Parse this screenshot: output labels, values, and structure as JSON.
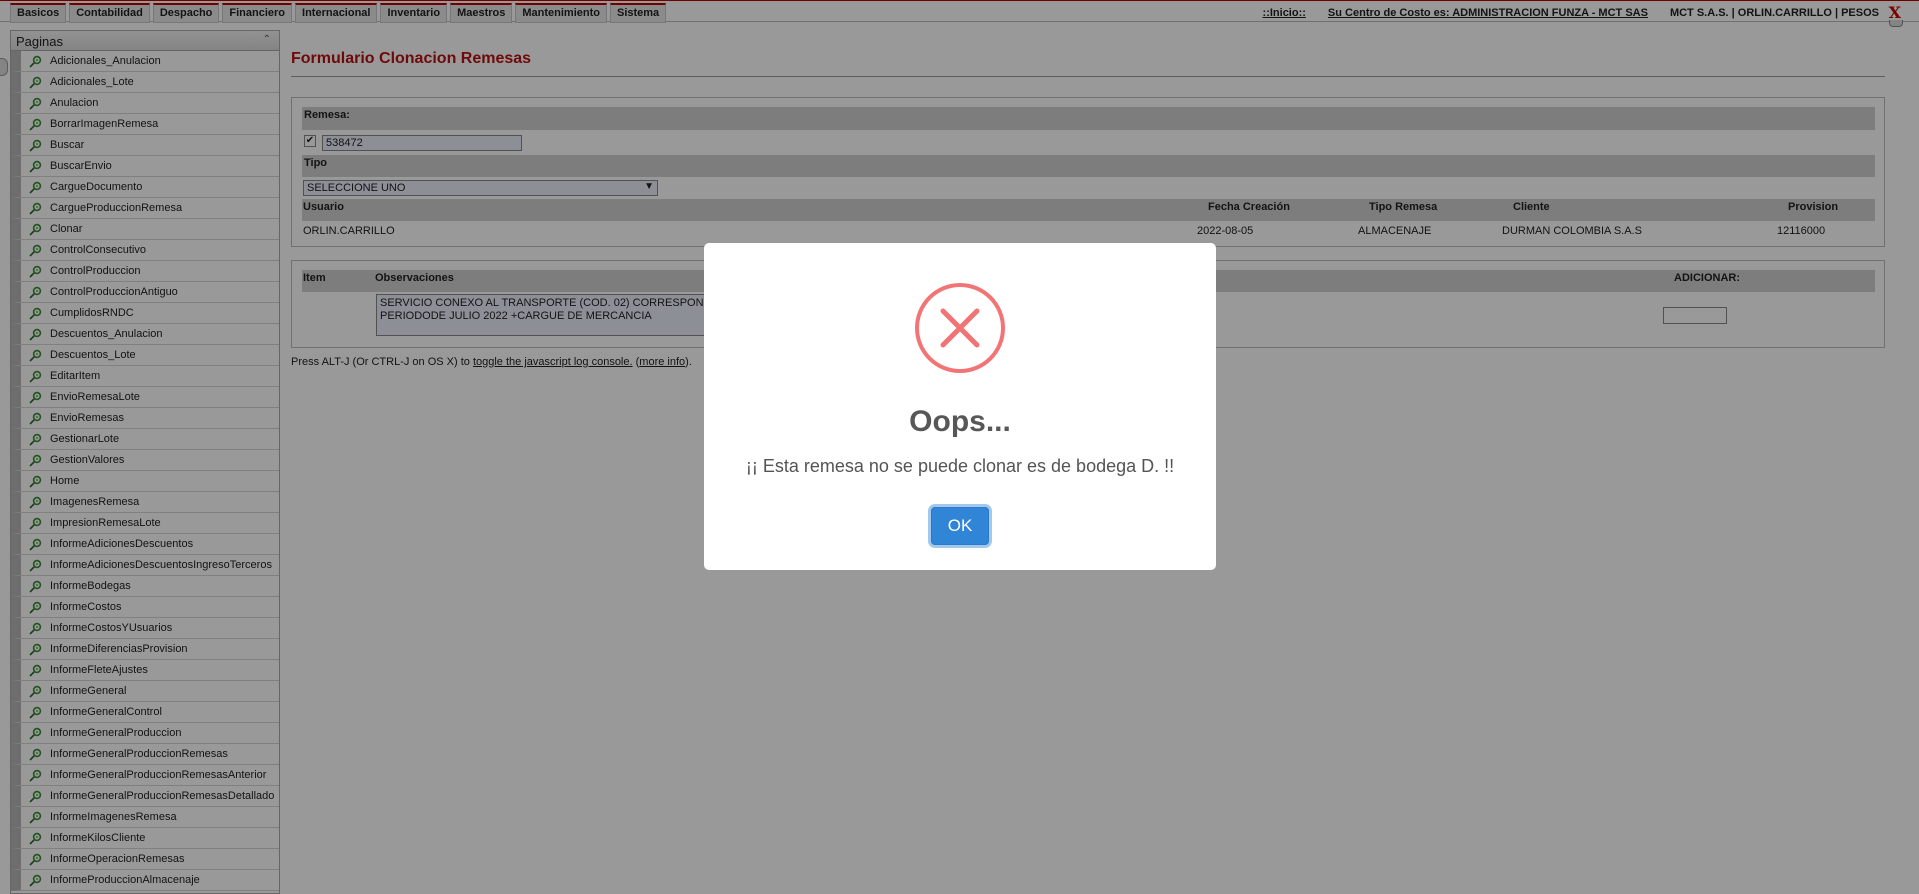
{
  "topbar": {
    "menu": [
      "Basicos",
      "Contabilidad",
      "Despacho",
      "Financiero",
      "Internacional",
      "Inventario",
      "Maestros",
      "Mantenimiento",
      "Sistema"
    ],
    "inicio": "::Inicio::",
    "cost_center": "Su Centro de Costo es: ADMINISTRACION FUNZA - MCT SAS",
    "user_info": "MCT S.A.S. | ORLIN.CARRILLO | PESOS",
    "close": "X"
  },
  "sidebar": {
    "title": "Paginas",
    "collapse_glyph": "⌃",
    "items": [
      "Adicionales_Anulacion",
      "Adicionales_Lote",
      "Anulacion",
      "BorrarImagenRemesa",
      "Buscar",
      "BuscarEnvio",
      "CargueDocumento",
      "CargueProduccionRemesa",
      "Clonar",
      "ControlConsecutivo",
      "ControlProduccion",
      "ControlProduccionAntiguo",
      "CumplidosRNDC",
      "Descuentos_Anulacion",
      "Descuentos_Lote",
      "EditarItem",
      "EnvioRemesaLote",
      "EnvioRemesas",
      "GestionarLote",
      "GestionValores",
      "Home",
      "ImagenesRemesa",
      "ImpresionRemesaLote",
      "InformeAdicionesDescuentos",
      "InformeAdicionesDescuentosIngresoTerceros",
      "InformeBodegas",
      "InformeCostos",
      "InformeCostosYUsuarios",
      "InformeDiferenciasProvision",
      "InformeFleteAjustes",
      "InformeGeneral",
      "InformeGeneralControl",
      "InformeGeneralProduccion",
      "InformeGeneralProduccionRemesas",
      "InformeGeneralProduccionRemesasAnterior",
      "InformeGeneralProduccionRemesasDetallado",
      "InformeImagenesRemesa",
      "InformeKilosCliente",
      "InformeOperacionRemesas",
      "InformeProduccionAlmacenaje"
    ]
  },
  "form": {
    "title": "Formulario Clonacion Remesas",
    "remesa_label": "Remesa:",
    "remesa_checked": "✔",
    "remesa_value": "538472",
    "tipo_label": "Tipo",
    "tipo_selected": "SELECCIONE UNO",
    "columns": {
      "usuario": "Usuario",
      "fecha": "Fecha Creación",
      "tipo_remesa": "Tipo Remesa",
      "cliente": "Cliente",
      "provision": "Provision"
    },
    "row": {
      "usuario": "ORLIN.CARRILLO",
      "fecha": "2022-08-05",
      "tipo_remesa": "ALMACENAJE",
      "cliente": "DURMAN COLOMBIA S.A.S",
      "provision": "12116000"
    },
    "items_header": {
      "item": "Item",
      "observaciones": "Observaciones",
      "adicionar": "ADICIONAR:"
    },
    "observaciones_text": "SERVICIO CONEXO AL TRANSPORTE (COD. 02) CORRESPONDIENTE AL PERIODODE JULIO 2022 +CARGUE DE MERCANCIA"
  },
  "log_hint": {
    "prefix": "Press ALT-J (Or CTRL-J on OS X) to ",
    "toggle_link": "toggle the javascript log console.",
    "mid": " (",
    "more_info": "more info",
    "suffix": ")."
  },
  "modal": {
    "title": "Oops...",
    "message": "¡¡ Esta remesa no se puede clonar es de bodega D. !!",
    "ok_label": "OK"
  },
  "colors": {
    "accent_red": "#bb1111",
    "error_icon": "#f27474",
    "ok_button": "#3085d6"
  }
}
